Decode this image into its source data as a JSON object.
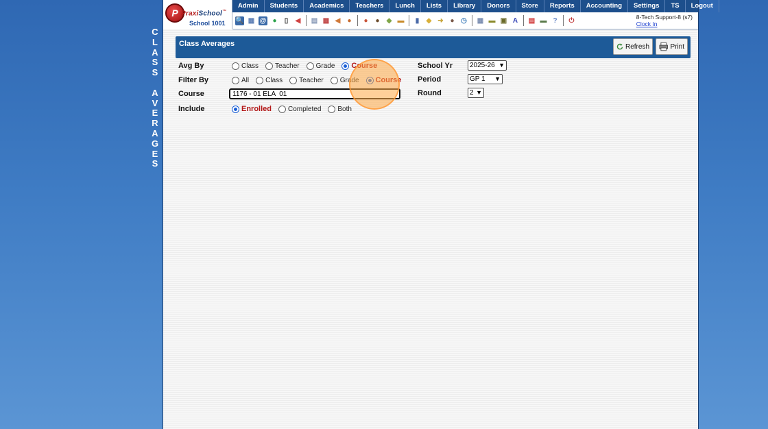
{
  "side_title_top": [
    "C",
    "L",
    "A",
    "S",
    "S"
  ],
  "side_title_bottom": [
    "A",
    "V",
    "E",
    "R",
    "A",
    "G",
    "E",
    "S"
  ],
  "logo": {
    "mark": "P",
    "brand_a": "Praxi",
    "brand_b": "School",
    "tm": "™",
    "school": "School 1001"
  },
  "nav": [
    "Admin",
    "Students",
    "Academics",
    "Teachers",
    "Lunch",
    "Lists",
    "Library",
    "Donors",
    "Store",
    "Reports",
    "Accounting",
    "Settings",
    "TS",
    "Logout"
  ],
  "toolbar_icons": [
    {
      "name": "search-icon",
      "glyph": "🔍",
      "color": "#ffffff"
    },
    {
      "name": "calendar-grid-icon",
      "glyph": "▦",
      "color": "#5d7fb5"
    },
    {
      "name": "at-icon",
      "glyph": "@",
      "color": "#ffffff"
    },
    {
      "name": "chat-icon",
      "glyph": "●",
      "color": "#2aa24a"
    },
    {
      "name": "phone-icon",
      "glyph": "▯",
      "color": "#333333"
    },
    {
      "name": "megaphone-icon",
      "glyph": "◀",
      "color": "#d04343"
    },
    {
      "name": "report-icon",
      "glyph": "▤",
      "color": "#8a9bb8"
    },
    {
      "name": "schedule-icon",
      "glyph": "▦",
      "color": "#c14848"
    },
    {
      "name": "announce-icon",
      "glyph": "◀",
      "color": "#d07a3a"
    },
    {
      "name": "student-icon",
      "glyph": "●",
      "color": "#c76a2e"
    },
    {
      "name": "student-alt-icon",
      "glyph": "●",
      "color": "#c9553a"
    },
    {
      "name": "group-icon",
      "glyph": "●",
      "color": "#6a4a2a"
    },
    {
      "name": "ticket-icon",
      "glyph": "◆",
      "color": "#7fa648"
    },
    {
      "name": "lunch-icon",
      "glyph": "▬",
      "color": "#c78a28"
    },
    {
      "name": "book-icon",
      "glyph": "▮",
      "color": "#4a6aa8"
    },
    {
      "name": "tag-icon",
      "glyph": "◆",
      "color": "#d9b03a"
    },
    {
      "name": "export-icon",
      "glyph": "➜",
      "color": "#c7a53a"
    },
    {
      "name": "user-icon",
      "glyph": "●",
      "color": "#7a5a4a"
    },
    {
      "name": "clock-icon",
      "glyph": "◷",
      "color": "#3a7ab8"
    },
    {
      "name": "table-icon",
      "glyph": "▦",
      "color": "#7a8db0"
    },
    {
      "name": "card-icon",
      "glyph": "▬",
      "color": "#8a8a2a"
    },
    {
      "name": "printer-icon",
      "glyph": "▣",
      "color": "#6a6a2a"
    },
    {
      "name": "asp-icon",
      "glyph": "A",
      "color": "#3a4ab8"
    },
    {
      "name": "pdf-icon",
      "glyph": "▤",
      "color": "#d03a3a"
    },
    {
      "name": "money-icon",
      "glyph": "▬",
      "color": "#5a7a4a"
    },
    {
      "name": "help-icon",
      "glyph": "?",
      "color": "#6a8ac8"
    },
    {
      "name": "power-icon",
      "glyph": "⏻",
      "color": "#c03a3a"
    }
  ],
  "user": {
    "name": "8-Tech Support-8 (s7)",
    "clock_in": "Clock In"
  },
  "panel": {
    "title": "Class Averages",
    "refresh": "Refresh",
    "print": "Print"
  },
  "avg_by": {
    "label": "Avg By",
    "options": [
      "Class",
      "Teacher",
      "Grade",
      "Course"
    ],
    "selected": "Course"
  },
  "filter_by": {
    "label": "Filter By",
    "options": [
      "All",
      "Class",
      "Teacher",
      "Grade",
      "Course"
    ],
    "selected": "Course"
  },
  "course": {
    "label": "Course",
    "value": "1176 - 01 ELA  01"
  },
  "include": {
    "label": "Include",
    "options": [
      "Enrolled",
      "Completed",
      "Both"
    ],
    "selected": "Enrolled"
  },
  "school_yr": {
    "label": "School Yr",
    "value": "2025-26"
  },
  "period": {
    "label": "Period",
    "value": "GP 1"
  },
  "round": {
    "label": "Round",
    "value": "2"
  }
}
